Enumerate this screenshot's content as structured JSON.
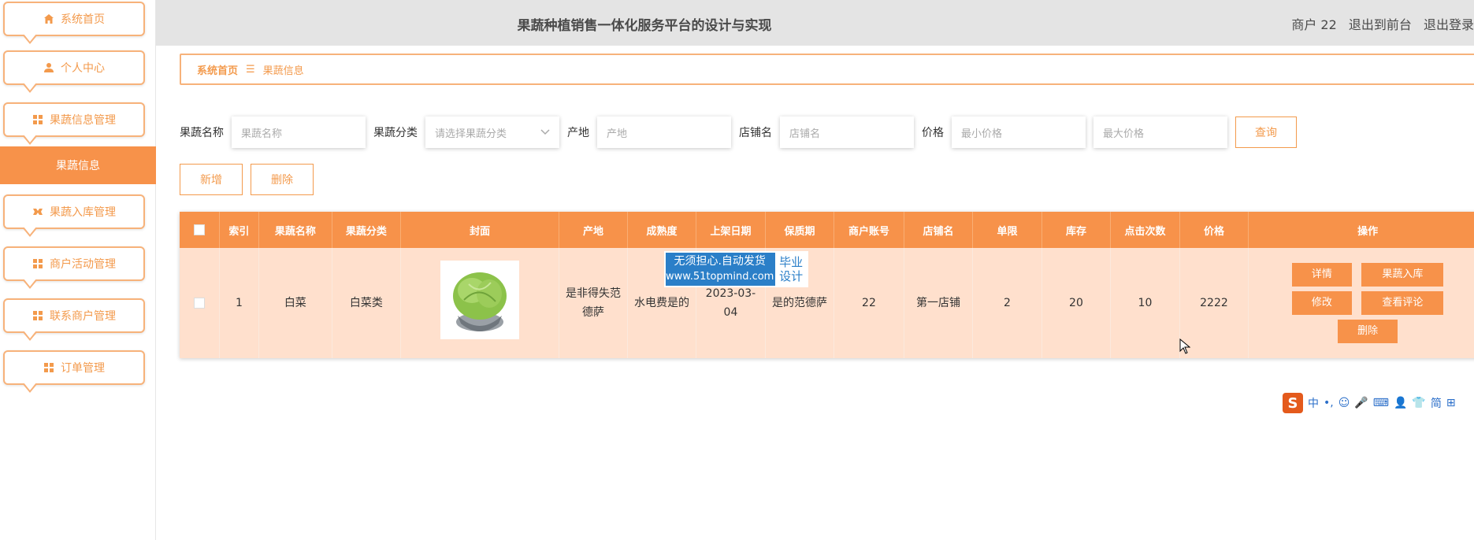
{
  "header": {
    "title": "果蔬种植销售一体化服务平台的设计与实现",
    "user": "商户 22",
    "links": [
      "退出到前台",
      "退出登录"
    ]
  },
  "sidebar": {
    "items": [
      {
        "label": "系统首页",
        "icon": "home-icon"
      },
      {
        "label": "个人中心",
        "icon": "user-icon"
      },
      {
        "label": "果蔬信息管理",
        "icon": "grid-icon"
      },
      {
        "label": "果蔬入库管理",
        "icon": "box-icon"
      },
      {
        "label": "商户活动管理",
        "icon": "grid-icon"
      },
      {
        "label": "联系商户管理",
        "icon": "grid-icon"
      },
      {
        "label": "订单管理",
        "icon": "grid-icon"
      }
    ],
    "active_sub": "果蔬信息"
  },
  "breadcrumb": {
    "home": "系统首页",
    "separator": "☰",
    "current": "果蔬信息"
  },
  "search": {
    "name_label": "果蔬名称",
    "name_placeholder": "果蔬名称",
    "category_label": "果蔬分类",
    "category_placeholder": "请选择果蔬分类",
    "origin_label": "产地",
    "origin_placeholder": "产地",
    "shop_label": "店铺名",
    "shop_placeholder": "店铺名",
    "price_label": "价格",
    "min_price_placeholder": "最小价格",
    "max_price_placeholder": "最大价格",
    "query_button": "查询"
  },
  "actions": {
    "add": "新增",
    "delete": "删除"
  },
  "table": {
    "headers": [
      "索引",
      "果蔬名称",
      "果蔬分类",
      "封面",
      "产地",
      "成熟度",
      "上架日期",
      "保质期",
      "商户账号",
      "店铺名",
      "单限",
      "库存",
      "点击次数",
      "价格",
      "操作"
    ],
    "rows": [
      {
        "index": "1",
        "name": "白菜",
        "category": "白菜类",
        "origin": "是非得失范德萨",
        "maturity": "水电费是的",
        "date": "2023-03-04",
        "shelf_life": "是的范德萨",
        "merchant": "22",
        "shop": "第一店铺",
        "limit": "2",
        "stock": "20",
        "clicks": "10",
        "price": "2222",
        "ops": {
          "detail": "详情",
          "stock_in": "果蔬入库",
          "edit": "修改",
          "reviews": "查看评论",
          "delete": "删除"
        }
      }
    ]
  },
  "watermark": {
    "line1": "无须担心.自动发货",
    "line2": "www.51topmind.com",
    "badge1": "毕业",
    "badge2": "设计"
  },
  "ime": {
    "logo": "S",
    "items": [
      "中",
      "•,",
      "☺",
      "🎤",
      "⌨",
      "👤",
      "👕",
      "简",
      "⊞"
    ]
  },
  "colors": {
    "accent": "#f7924a",
    "row_bg": "#ffe0cd",
    "header_bg": "#e4e4e4"
  }
}
